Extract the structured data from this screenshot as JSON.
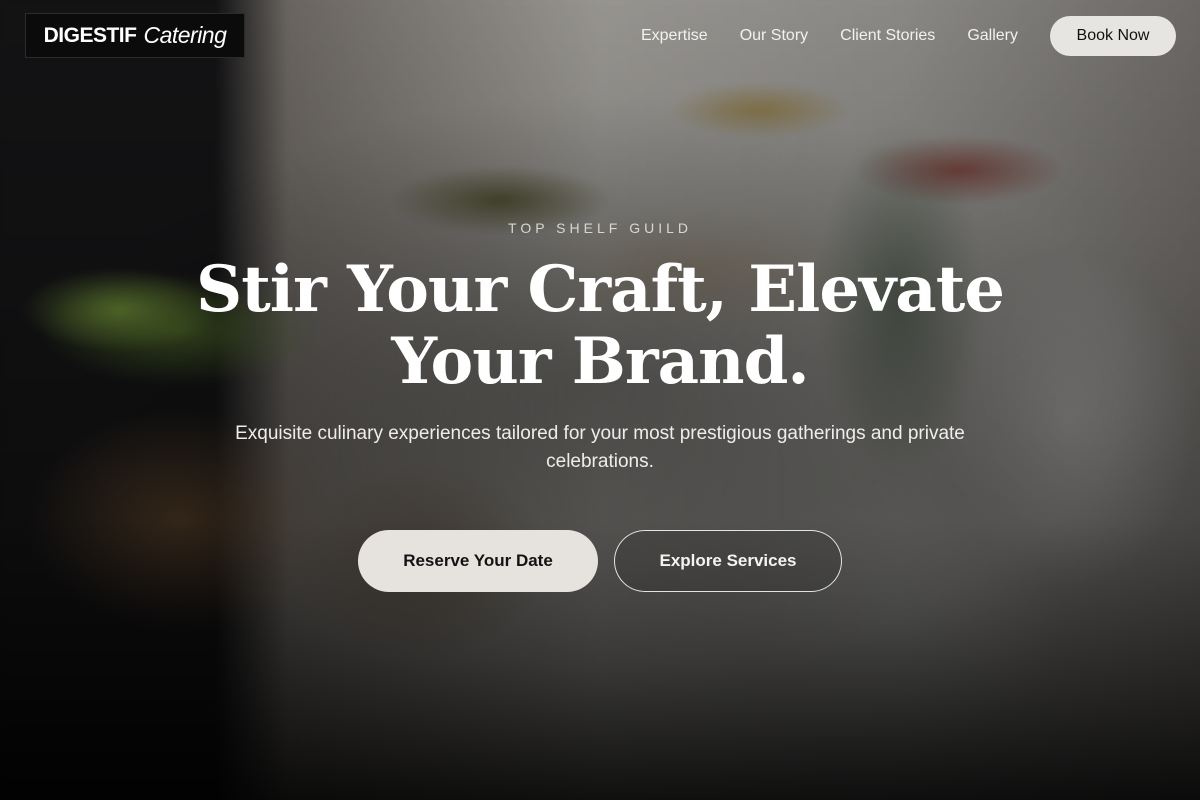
{
  "header": {
    "logo": {
      "primary": "DIGESTIF",
      "secondary": "Catering"
    },
    "nav": [
      {
        "label": "Expertise"
      },
      {
        "label": "Our Story"
      },
      {
        "label": "Client Stories"
      },
      {
        "label": "Gallery"
      }
    ],
    "cta_label": "Book Now"
  },
  "hero": {
    "eyebrow": "TOP SHELF GUILD",
    "headline": "Stir Your Craft, Elevate Your Brand.",
    "subtitle": "Exquisite culinary experiences tailored for your most prestigious gatherings and private celebrations.",
    "primary_button": "Reserve Your Date",
    "secondary_button": "Explore Services"
  },
  "colors": {
    "button_light": "#e6e3df",
    "text_light": "#ffffff",
    "overlay_dark": "#0e0c0a"
  }
}
